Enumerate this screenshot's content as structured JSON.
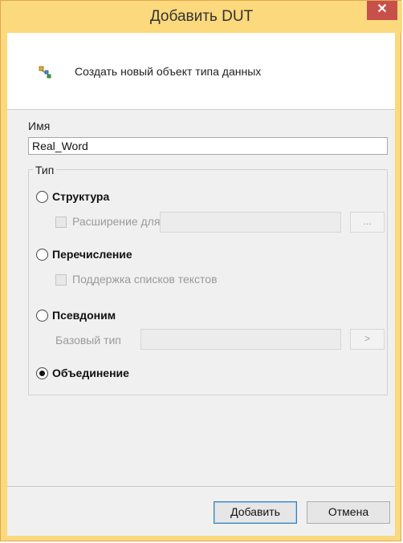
{
  "window": {
    "title": "Добавить DUT",
    "close_glyph": "✕"
  },
  "header": {
    "icon": "dut-object-icon",
    "text": "Создать новый объект типа данных"
  },
  "name_section": {
    "label": "Имя",
    "value": "Real_Word"
  },
  "type_group": {
    "legend": "Тип",
    "options": [
      {
        "label": "Структура",
        "selected": false
      },
      {
        "label": "Перечисление",
        "selected": false
      },
      {
        "label": "Псевдоним",
        "selected": false
      },
      {
        "label": "Объединение",
        "selected": true
      }
    ],
    "extension_checkbox_label": "Расширение для",
    "extension_browse_label": "...",
    "text_list_checkbox_label": "Поддержка списков текстов",
    "base_type_label": "Базовый тип",
    "base_type_button_label": ">"
  },
  "footer": {
    "add_label": "Добавить",
    "cancel_label": "Отмена"
  },
  "colors": {
    "titlebar": "#fbd97c",
    "close": "#c7504a",
    "client": "#f0f0f0"
  }
}
